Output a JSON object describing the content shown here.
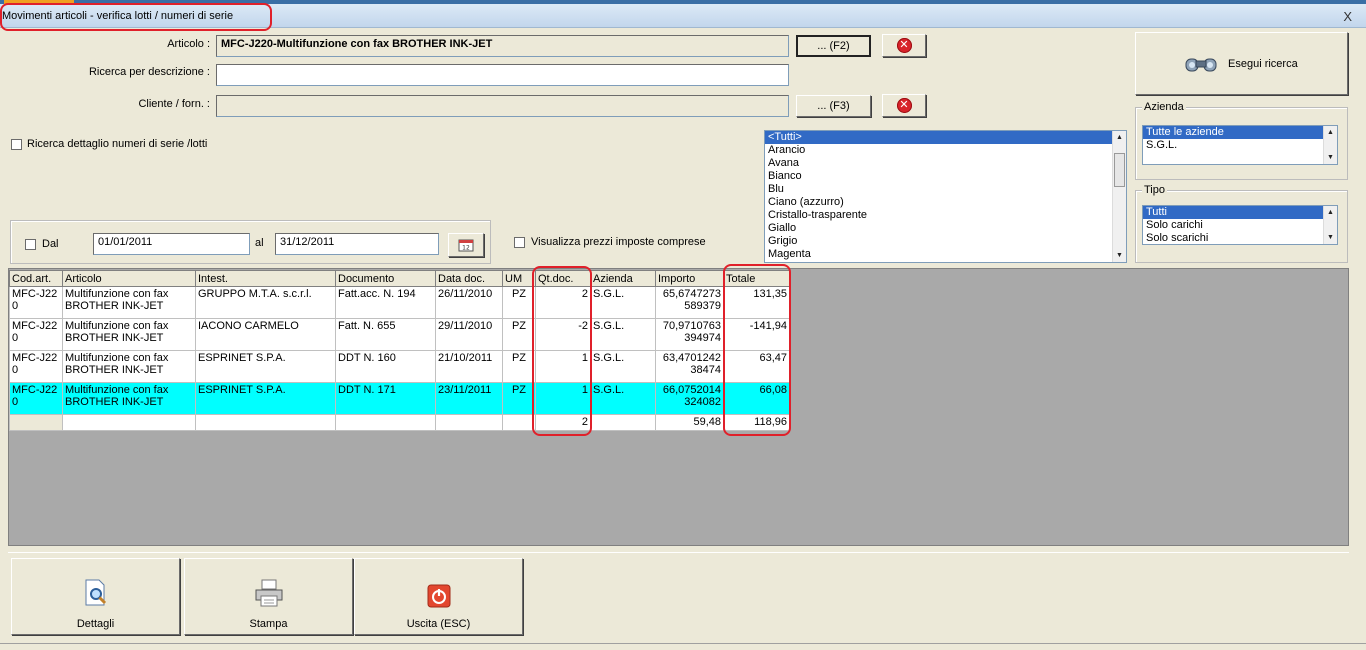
{
  "window": {
    "title": "Movimenti articoli - verifica lotti / numeri di serie",
    "close_glyph": "X"
  },
  "form": {
    "articolo_label": "Articolo :",
    "articolo_value": "MFC-J220-Multifunzione con fax BROTHER INK-JET",
    "articolo_btn": "... (F2)",
    "ricerca_label": "Ricerca per descrizione :",
    "ricerca_value": "",
    "cliente_label": "Cliente / forn. :",
    "cliente_value": "",
    "cliente_btn": "... (F3)",
    "dettaglio_label": "Ricerca dettaglio numeri di serie /lotti",
    "dal_label": "Dal",
    "dal_value": "01/01/2011",
    "al_label": "al",
    "al_value": "31/12/2011",
    "prezzi_label": "Visualizza prezzi imposte comprese"
  },
  "esegui": {
    "label": "Esegui ricerca",
    "icon": "binoculars-icon"
  },
  "colori": [
    "<Tutti>",
    "Arancio",
    "Avana",
    "Bianco",
    "Blu",
    "Ciano (azzurro)",
    "Cristallo-trasparente",
    "Giallo",
    "Grigio",
    "Magenta"
  ],
  "azienda": {
    "title": "Azienda",
    "items": [
      "Tutte le aziende",
      "S.G.L."
    ]
  },
  "tipo": {
    "title": "Tipo",
    "items": [
      "Tutti",
      "Solo carichi",
      "Solo scarichi"
    ]
  },
  "grid": {
    "headers": [
      "Cod.art.",
      "Articolo",
      "Intest.",
      "Documento",
      "Data doc.",
      "UM",
      "Qt.doc.",
      "Azienda",
      "Importo",
      "Totale"
    ],
    "rows": [
      {
        "cod": "MFC-J22 0",
        "articolo": "Multifunzione con fax BROTHER INK-JET",
        "intest": "GRUPPO M.T.A. s.c.r.l.",
        "documento": "Fatt.acc. N. 194",
        "data": "26/11/2010",
        "um": "PZ",
        "qt": "2",
        "azienda": "S.G.L.",
        "importo": "65,6747273 589379",
        "totale": "131,35"
      },
      {
        "cod": "MFC-J22 0",
        "articolo": "Multifunzione con fax BROTHER INK-JET",
        "intest": "IACONO CARMELO",
        "documento": "Fatt. N. 655",
        "data": "29/11/2010",
        "um": "PZ",
        "qt": "-2",
        "azienda": "S.G.L.",
        "importo": "70,9710763 394974",
        "totale": "-141,94"
      },
      {
        "cod": "MFC-J22 0",
        "articolo": "Multifunzione con fax BROTHER INK-JET",
        "intest": "ESPRINET S.P.A.",
        "documento": "DDT N. 160",
        "data": "21/10/2011",
        "um": "PZ",
        "qt": "1",
        "azienda": "S.G.L.",
        "importo": "63,4701242 38474",
        "totale": "63,47"
      },
      {
        "cod": "MFC-J22 0",
        "articolo": "Multifunzione con fax BROTHER INK-JET",
        "intest": "ESPRINET S.P.A.",
        "documento": "DDT N. 171",
        "data": "23/11/2011",
        "um": "PZ",
        "qt": "1",
        "azienda": "S.G.L.",
        "importo": "66,0752014 324082",
        "totale": "66,08"
      }
    ],
    "summary": {
      "qt": "2",
      "importo": "59,48",
      "totale": "118,96"
    }
  },
  "buttons": {
    "dettagli": "Dettagli",
    "stampa": "Stampa",
    "uscita": "Uscita (ESC)"
  },
  "colors": {
    "highlight_row": "#00ffff",
    "annotation": "#e0202a",
    "selection": "#316ac5"
  }
}
